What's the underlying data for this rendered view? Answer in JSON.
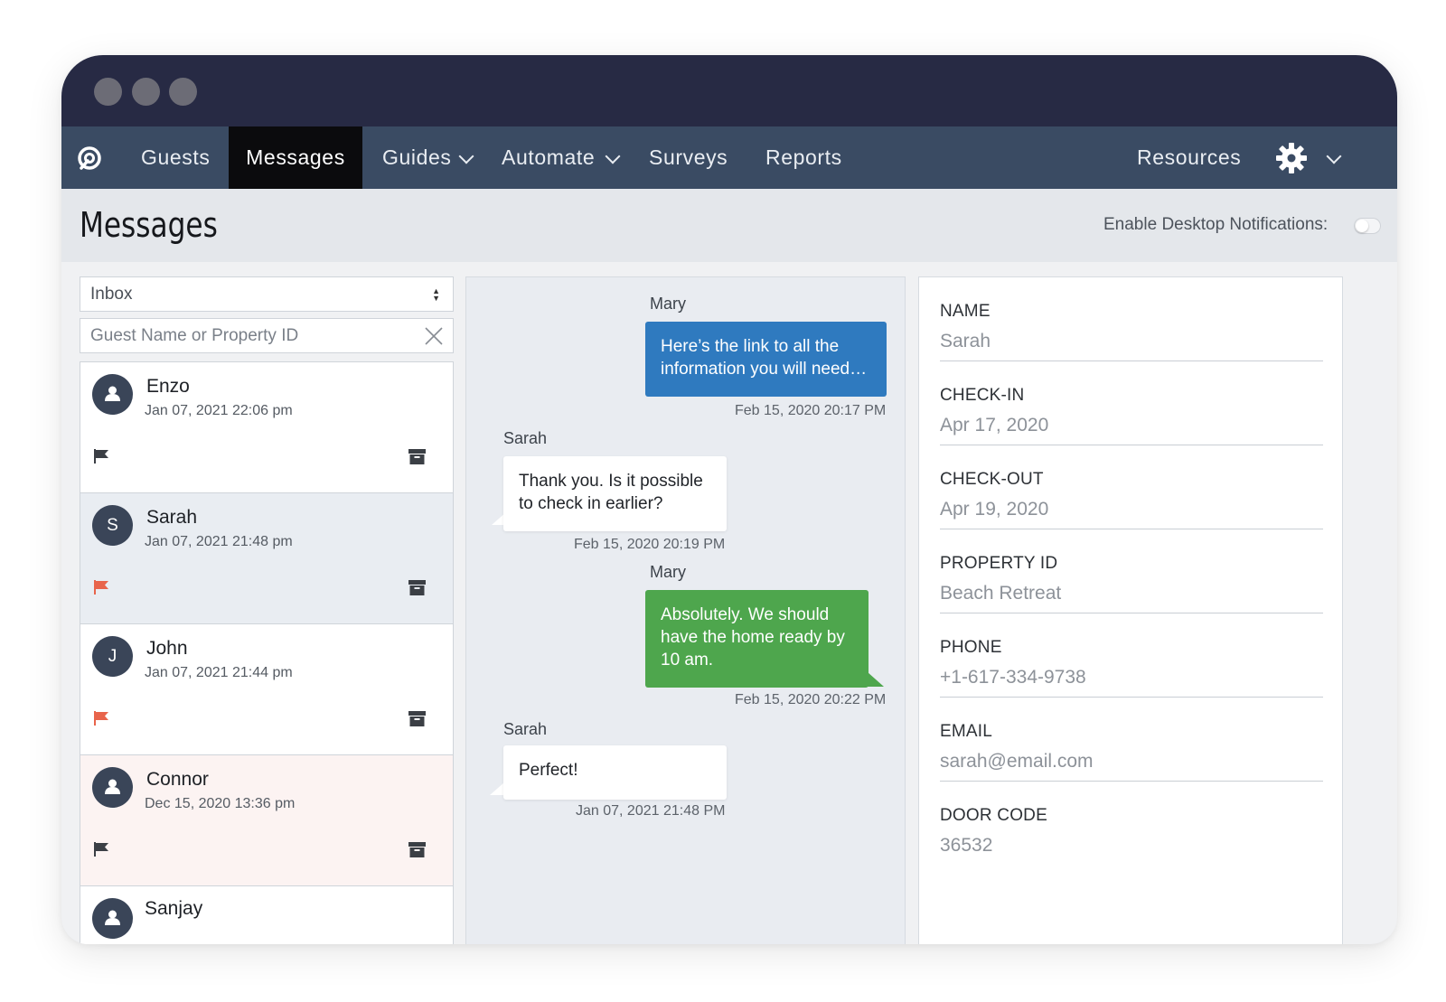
{
  "nav": {
    "logo_icon": "app-logo-icon",
    "items": [
      {
        "label": "Guests"
      },
      {
        "label": "Messages",
        "active": true
      },
      {
        "label": "Guides",
        "dropdown": true
      },
      {
        "label": "Automate",
        "dropdown": true
      },
      {
        "label": "Surveys"
      },
      {
        "label": "Reports"
      }
    ],
    "resources": "Resources",
    "settings_icon": "gear-icon"
  },
  "header": {
    "title": "Messages",
    "notifications_label": "Enable Desktop Notifications:",
    "notifications_enabled": false
  },
  "filters": {
    "mailbox": "Inbox",
    "search_placeholder": "Guest Name or Property ID"
  },
  "conversations": [
    {
      "name": "Enzo",
      "initial": "",
      "time": "Jan 07, 2021 22:06 pm",
      "flag_color": "#3b3f45",
      "selected": false
    },
    {
      "name": "Sarah",
      "initial": "S",
      "time": "Jan 07, 2021 21:48 pm",
      "flag_color": "#e8644b",
      "selected": true
    },
    {
      "name": "John",
      "initial": "J",
      "time": "Jan 07, 2021 21:44 pm",
      "flag_color": "#e8644b",
      "selected": false
    },
    {
      "name": "Connor",
      "initial": "",
      "time": "Dec 15, 2020 13:36 pm",
      "flag_color": "#3b3f45",
      "selected": false
    },
    {
      "name": "Sanjay",
      "initial": "",
      "time": "",
      "flag_color": "#3b3f45",
      "selected": false
    }
  ],
  "messages": [
    {
      "sender": "Mary",
      "text": "Here’s the link to all the information you will need…",
      "time": "Feb 15, 2020 20:17 PM",
      "direction": "out",
      "color": "#2f7abf"
    },
    {
      "sender": "Sarah",
      "text": "Thank you. Is it possible to check in earlier?",
      "time": "Feb 15, 2020 20:19 PM",
      "direction": "in"
    },
    {
      "sender": "Mary",
      "text": "Absolutely. We should have the home ready by 10 am.",
      "time": "Feb 15, 2020 20:22 PM",
      "direction": "out",
      "color": "#4ea64d"
    },
    {
      "sender": "Sarah",
      "text": "Perfect!",
      "time": "Jan 07, 2021 21:48 PM",
      "direction": "in"
    }
  ],
  "guest_details": [
    {
      "label": "NAME",
      "value": "Sarah"
    },
    {
      "label": "CHECK-IN",
      "value": "Apr 17, 2020"
    },
    {
      "label": "CHECK-OUT",
      "value": "Apr 19, 2020"
    },
    {
      "label": "PROPERTY ID",
      "value": "Beach Retreat"
    },
    {
      "label": "PHONE",
      "value": "+1-617-334-9738"
    },
    {
      "label": "EMAIL",
      "value": "sarah@email.com"
    },
    {
      "label": "DOOR CODE",
      "value": "36532"
    }
  ],
  "colors": {
    "titlebar": "#272a44",
    "navbar": "#3a4b63",
    "nav_active": "#0b0b0d",
    "selected_row": "#e9edf2",
    "unread_row": "#fcf3f2"
  }
}
